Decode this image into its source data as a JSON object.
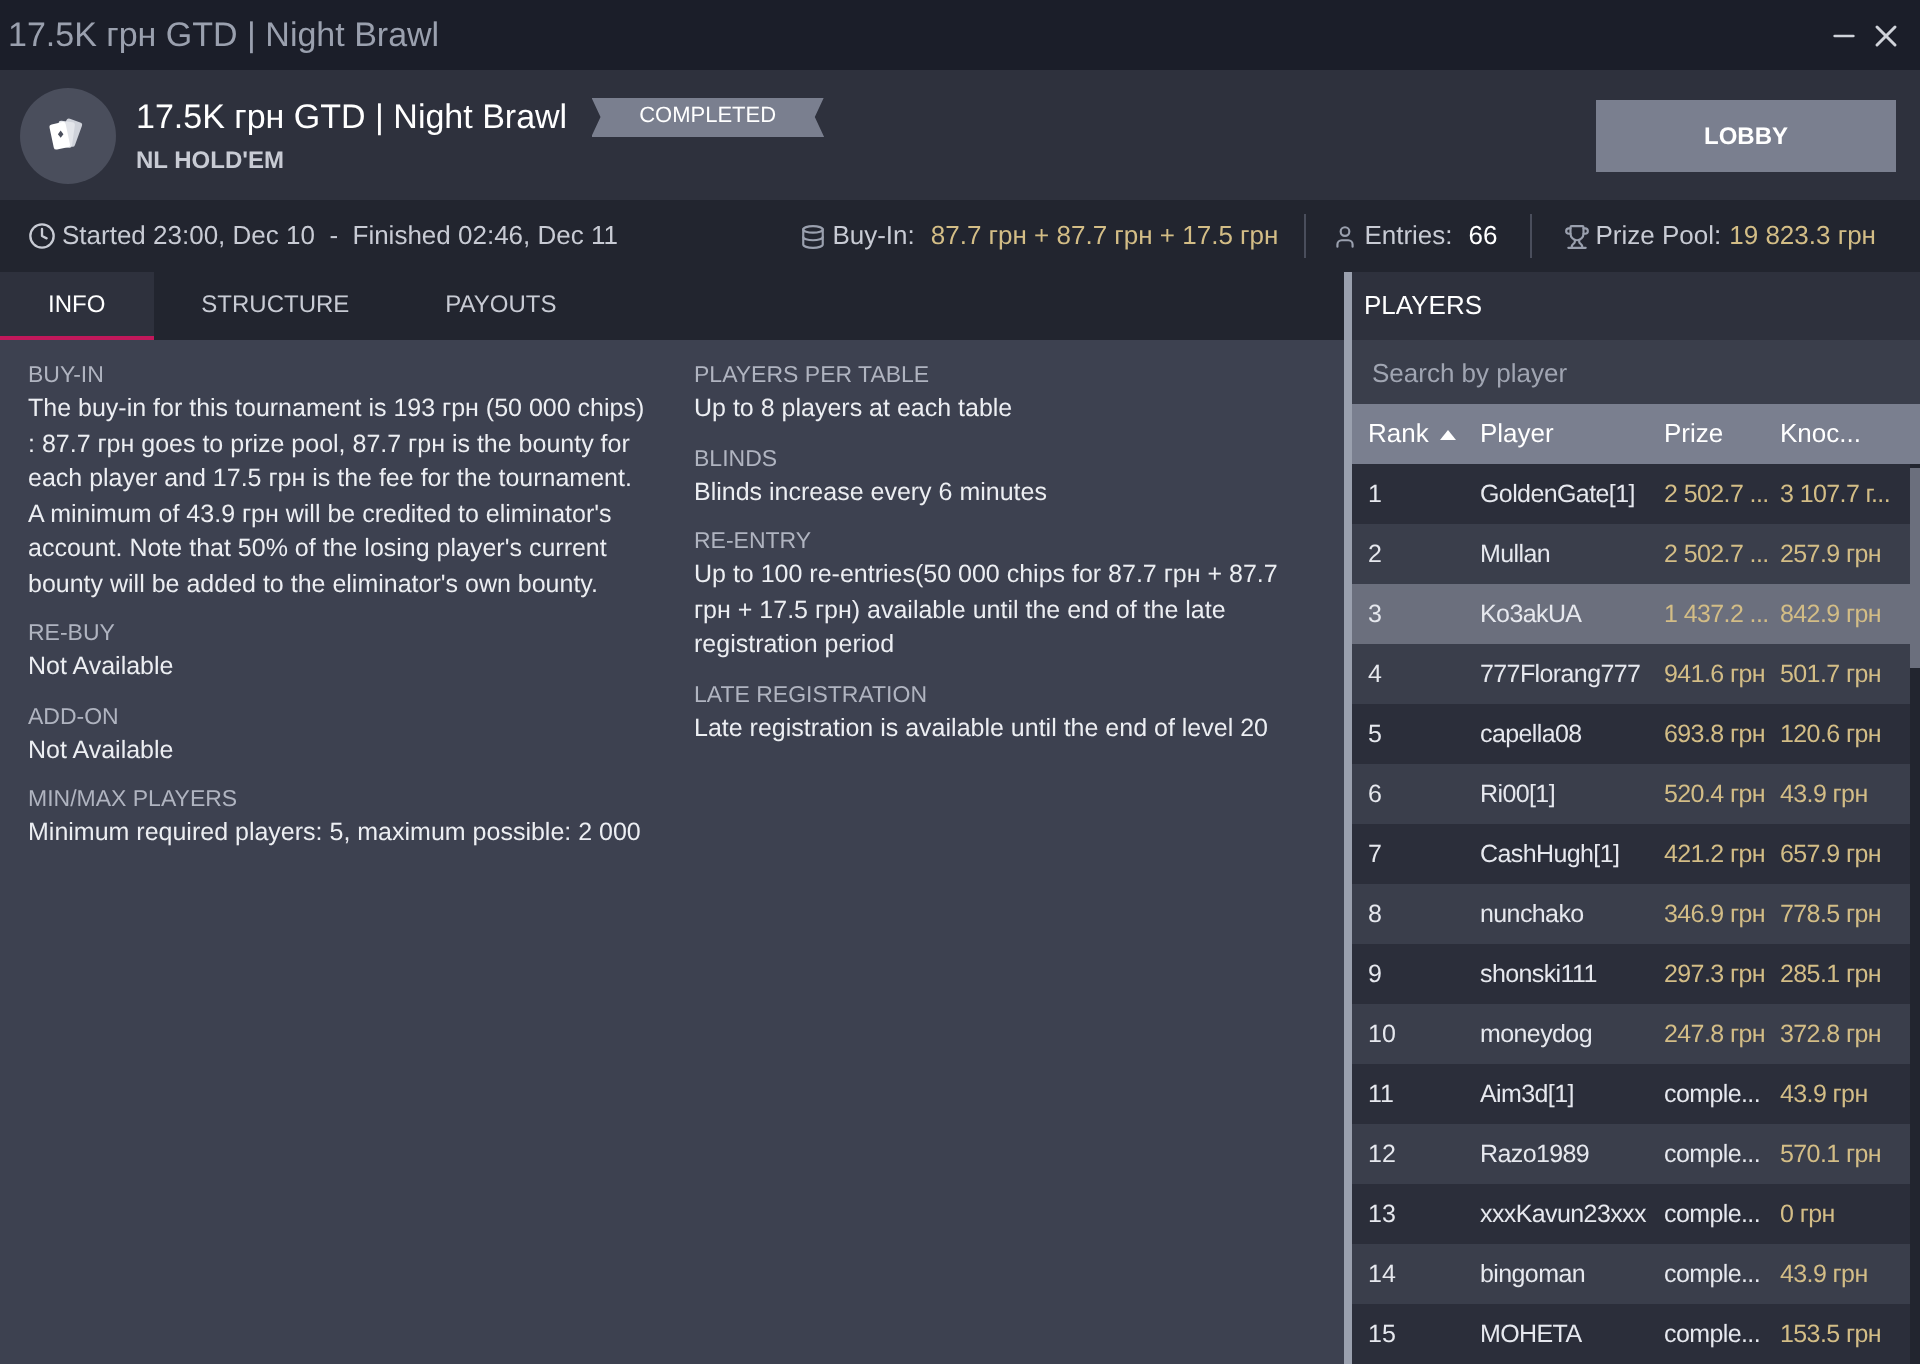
{
  "window": {
    "title": "17.5K грн GTD | Night Brawl"
  },
  "header": {
    "title": "17.5K грн GTD | Night Brawl",
    "game": "NL HOLD'EM",
    "status": "COMPLETED",
    "lobby_button": "LOBBY"
  },
  "info_bar": {
    "time": "Started 23:00, Dec 10  -  Finished 02:46, Dec 11",
    "buy_in_label": "Buy-In:",
    "buy_in": "87.7 грн + 87.7 грн + 17.5 грн",
    "entries_label": "Entries:",
    "entries": "66",
    "prize_pool_label": "Prize Pool:",
    "prize_pool": "19 823.3 грн"
  },
  "tabs": [
    {
      "label": "INFO",
      "selected": true
    },
    {
      "label": "STRUCTURE",
      "selected": false
    },
    {
      "label": "PAYOUTS",
      "selected": false
    }
  ],
  "info_columns": [
    [
      {
        "heading": "BUY-IN",
        "text": "The buy-in for this tournament is 193 грн (50 000 chips) : 87.7 грн goes to prize pool, 87.7 грн is the bounty for each player and 17.5 грн is the fee for the tournament. A minimum of 43.9 грн will be credited to eliminator's account. Note that 50% of the losing player's current bounty will be added to the eliminator's own bounty."
      },
      {
        "heading": "RE-BUY",
        "text": "Not Available"
      },
      {
        "heading": "ADD-ON",
        "text": "Not Available"
      },
      {
        "heading": "MIN/MAX PLAYERS",
        "text": "Minimum required players: 5, maximum possible: 2 000"
      }
    ],
    [
      {
        "heading": "PLAYERS PER TABLE",
        "text": "Up to 8 players at each table"
      },
      {
        "heading": "BLINDS",
        "text": "Blinds increase every 6 minutes"
      },
      {
        "heading": "RE-ENTRY",
        "text": "Up to 100 re-entries(50 000 chips for 87.7 грн + 87.7 грн + 17.5 грн) available until the end of the late registration period"
      },
      {
        "heading": "LATE REGISTRATION",
        "text": "Late registration is available until the end of level 20"
      }
    ]
  ],
  "players": {
    "title": "PLAYERS",
    "search": {
      "placeholder": "Search by player"
    },
    "columns": [
      {
        "label": "Rank",
        "sorted": true
      },
      {
        "label": "Player",
        "sorted": false
      },
      {
        "label": "Prize",
        "sorted": false
      },
      {
        "label": "Knoc...",
        "sorted": false
      }
    ],
    "rows": [
      {
        "rank": "1",
        "player": "GoldenGate[1]",
        "prize": {
          "text": "2 502.7 ...",
          "kind": "amount"
        },
        "knockouts": "3 107.7 г...",
        "selected": false
      },
      {
        "rank": "2",
        "player": "Mullan",
        "prize": {
          "text": "2 502.7 ...",
          "kind": "amount"
        },
        "knockouts": "257.9 грн",
        "selected": false
      },
      {
        "rank": "3",
        "player": "Ko3akUA",
        "prize": {
          "text": "1 437.2 ...",
          "kind": "amount"
        },
        "knockouts": "842.9 грн",
        "selected": true
      },
      {
        "rank": "4",
        "player": "777Florang777",
        "prize": {
          "text": "941.6 грн",
          "kind": "amount"
        },
        "knockouts": "501.7 грн",
        "selected": false
      },
      {
        "rank": "5",
        "player": "capella08",
        "prize": {
          "text": "693.8 грн",
          "kind": "amount"
        },
        "knockouts": "120.6 грн",
        "selected": false
      },
      {
        "rank": "6",
        "player": "Ri00[1]",
        "prize": {
          "text": "520.4 грн",
          "kind": "amount"
        },
        "knockouts": "43.9 грн",
        "selected": false
      },
      {
        "rank": "7",
        "player": "CashHugh[1]",
        "prize": {
          "text": "421.2 грн",
          "kind": "amount"
        },
        "knockouts": "657.9 грн",
        "selected": false
      },
      {
        "rank": "8",
        "player": "nunchako",
        "prize": {
          "text": "346.9 грн",
          "kind": "amount"
        },
        "knockouts": "778.5 грн",
        "selected": false
      },
      {
        "rank": "9",
        "player": "shonski111",
        "prize": {
          "text": "297.3 грн",
          "kind": "amount"
        },
        "knockouts": "285.1 грн",
        "selected": false
      },
      {
        "rank": "10",
        "player": "moneydog",
        "prize": {
          "text": "247.8 грн",
          "kind": "amount"
        },
        "knockouts": "372.8 грн",
        "selected": false
      },
      {
        "rank": "11",
        "player": "Aim3d[1]",
        "prize": {
          "text": "comple...",
          "kind": "status"
        },
        "knockouts": "43.9 грн",
        "selected": false
      },
      {
        "rank": "12",
        "player": "Razo1989",
        "prize": {
          "text": "comple...",
          "kind": "status"
        },
        "knockouts": "570.1 грн",
        "selected": false
      },
      {
        "rank": "13",
        "player": "xxxKavun23xxx",
        "prize": {
          "text": "comple...",
          "kind": "status"
        },
        "knockouts": "0 грн",
        "selected": false
      },
      {
        "rank": "14",
        "player": "bingoman",
        "prize": {
          "text": "comple...",
          "kind": "status"
        },
        "knockouts": "43.9 грн",
        "selected": false
      },
      {
        "rank": "15",
        "player": "MOHETA",
        "prize": {
          "text": "comple...",
          "kind": "status"
        },
        "knockouts": "153.5 грн",
        "selected": false
      }
    ]
  }
}
